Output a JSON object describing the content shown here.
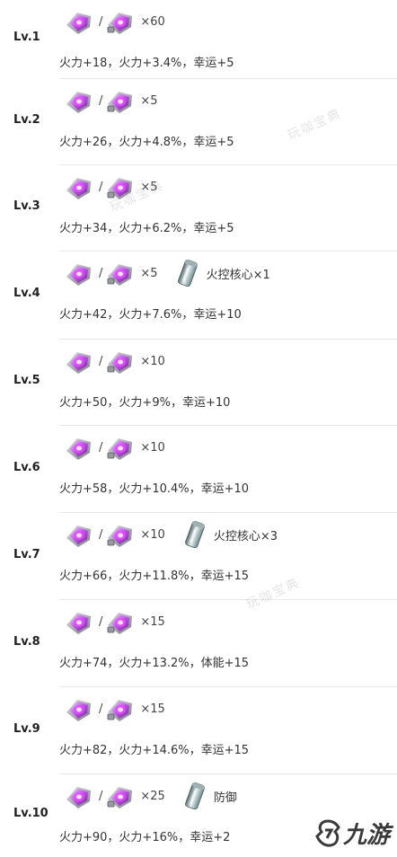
{
  "rows": [
    {
      "level": "Lv.1",
      "qty": "×60",
      "core": "",
      "stats": "火力+18，火力+3.4%，幸运+5"
    },
    {
      "level": "Lv.2",
      "qty": "×5",
      "core": "",
      "stats": "火力+26，火力+4.8%，幸运+5"
    },
    {
      "level": "Lv.3",
      "qty": "×5",
      "core": "",
      "stats": "火力+34，火力+6.2%，幸运+5"
    },
    {
      "level": "Lv.4",
      "qty": "×5",
      "core": "火控核心×1",
      "stats": "火力+42，火力+7.6%，幸运+10"
    },
    {
      "level": "Lv.5",
      "qty": "×10",
      "core": "",
      "stats": "火力+50，火力+9%，幸运+10"
    },
    {
      "level": "Lv.6",
      "qty": "×10",
      "core": "",
      "stats": "火力+58，火力+10.4%，幸运+10"
    },
    {
      "level": "Lv.7",
      "qty": "×10",
      "core": "火控核心×3",
      "stats": "火力+66，火力+11.8%，幸运+15"
    },
    {
      "level": "Lv.8",
      "qty": "×15",
      "core": "",
      "stats": "火力+74，火力+13.2%，体能+15"
    },
    {
      "level": "Lv.9",
      "qty": "×15",
      "core": "",
      "stats": "火力+82，火力+14.6%，幸运+15"
    },
    {
      "level": "Lv.10",
      "qty": "×25",
      "core": "防御",
      "stats": "火力+90，火力+16%，幸运+2"
    }
  ],
  "separator": "/",
  "watermark": "玩咖宝典",
  "logo_text": "九游",
  "colors": {
    "gem": "#b14fe0",
    "core": "#8fb4bc"
  }
}
